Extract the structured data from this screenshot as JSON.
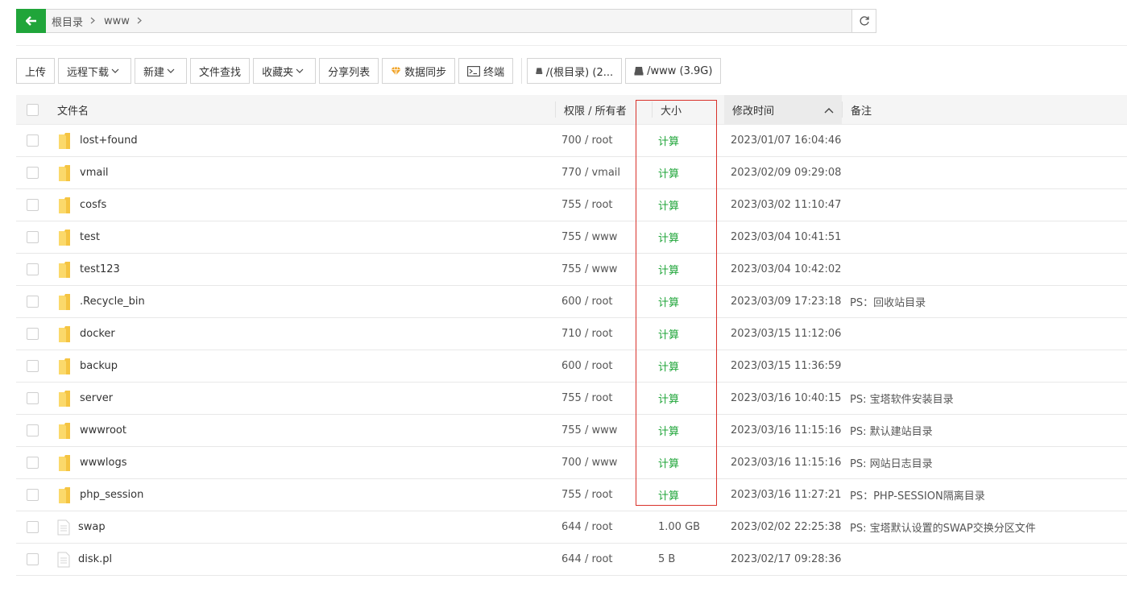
{
  "breadcrumb": {
    "items": [
      "根目录",
      "www"
    ]
  },
  "toolbar": {
    "upload": "上传",
    "remote_download": "远程下载",
    "new": "新建",
    "file_search": "文件查找",
    "favorites": "收藏夹",
    "share_list": "分享列表",
    "data_sync": "数据同步",
    "terminal": "终端",
    "disk_root": "/(根目录) (2...",
    "disk_www": "/www (3.9G)"
  },
  "table": {
    "headers": {
      "name": "文件名",
      "perm": "权限 / 所有者",
      "size": "大小",
      "mtime": "修改时间",
      "note": "备注"
    },
    "rows": [
      {
        "type": "folder",
        "name": "lost+found",
        "perm": "700 / root",
        "size": "计算",
        "size_calc": true,
        "mtime": "2023/01/07 16:04:46",
        "note": ""
      },
      {
        "type": "folder",
        "name": "vmail",
        "perm": "770 / vmail",
        "size": "计算",
        "size_calc": true,
        "mtime": "2023/02/09 09:29:08",
        "note": ""
      },
      {
        "type": "folder",
        "name": "cosfs",
        "perm": "755 / root",
        "size": "计算",
        "size_calc": true,
        "mtime": "2023/03/02 11:10:47",
        "note": ""
      },
      {
        "type": "folder",
        "name": "test",
        "perm": "755 / www",
        "size": "计算",
        "size_calc": true,
        "mtime": "2023/03/04 10:41:51",
        "note": ""
      },
      {
        "type": "folder",
        "name": "test123",
        "perm": "755 / www",
        "size": "计算",
        "size_calc": true,
        "mtime": "2023/03/04 10:42:02",
        "note": ""
      },
      {
        "type": "folder",
        "name": ".Recycle_bin",
        "perm": "600 / root",
        "size": "计算",
        "size_calc": true,
        "mtime": "2023/03/09 17:23:18",
        "note": "PS：回收站目录"
      },
      {
        "type": "folder",
        "name": "docker",
        "perm": "710 / root",
        "size": "计算",
        "size_calc": true,
        "mtime": "2023/03/15 11:12:06",
        "note": ""
      },
      {
        "type": "folder",
        "name": "backup",
        "perm": "600 / root",
        "size": "计算",
        "size_calc": true,
        "mtime": "2023/03/15 11:36:59",
        "note": ""
      },
      {
        "type": "folder",
        "name": "server",
        "perm": "755 / root",
        "size": "计算",
        "size_calc": true,
        "mtime": "2023/03/16 10:40:15",
        "note": "PS: 宝塔软件安装目录"
      },
      {
        "type": "folder",
        "name": "wwwroot",
        "perm": "755 / www",
        "size": "计算",
        "size_calc": true,
        "mtime": "2023/03/16 11:15:16",
        "note": "PS: 默认建站目录"
      },
      {
        "type": "folder",
        "name": "wwwlogs",
        "perm": "700 / www",
        "size": "计算",
        "size_calc": true,
        "mtime": "2023/03/16 11:15:16",
        "note": "PS: 网站日志目录"
      },
      {
        "type": "folder",
        "name": "php_session",
        "perm": "755 / root",
        "size": "计算",
        "size_calc": true,
        "mtime": "2023/03/16 11:27:21",
        "note": "PS：PHP-SESSION隔离目录"
      },
      {
        "type": "file",
        "name": "swap",
        "perm": "644 / root",
        "size": "1.00 GB",
        "size_calc": false,
        "mtime": "2023/02/02 22:25:38",
        "note": "PS: 宝塔默认设置的SWAP交换分区文件"
      },
      {
        "type": "file",
        "name": "disk.pl",
        "perm": "644 / root",
        "size": "5 B",
        "size_calc": false,
        "mtime": "2023/02/17 09:28:36",
        "note": ""
      }
    ]
  },
  "colors": {
    "accent": "#20a53a",
    "highlight": "#d9322b",
    "folder": "#f5c441"
  }
}
